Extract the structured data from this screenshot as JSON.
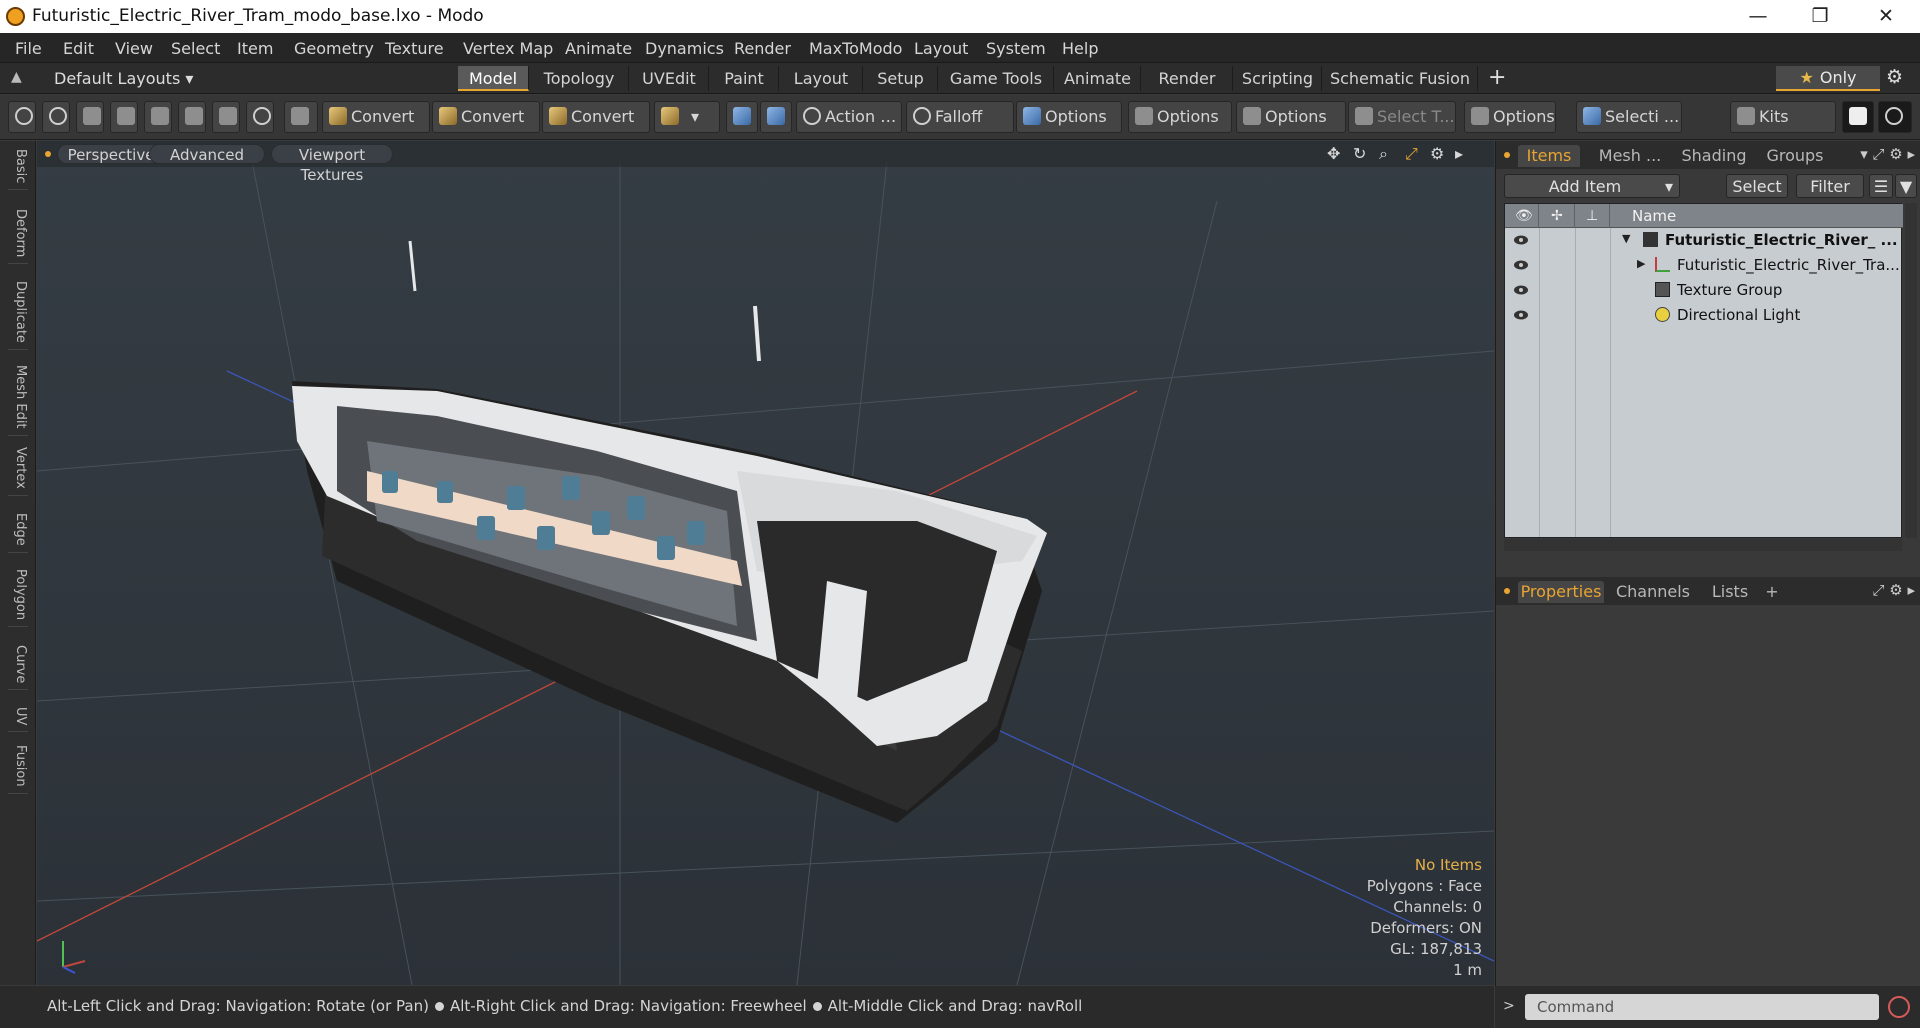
{
  "window": {
    "title": "Futuristic_Electric_River_Tram_modo_base.lxo - Modo",
    "minimize": "—",
    "maximize": "❐",
    "close": "✕"
  },
  "menu": [
    "File",
    "Edit",
    "View",
    "Select",
    "Item",
    "Geometry",
    "Texture",
    "Vertex Map",
    "Animate",
    "Dynamics",
    "Render",
    "MaxToModo",
    "Layout",
    "System",
    "Help"
  ],
  "layout_tabs": {
    "selector": "Default Layouts ▾",
    "tabs": [
      "Model",
      "Topology",
      "UVEdit",
      "Paint",
      "Layout",
      "Setup",
      "Game Tools",
      "Animate",
      "Render",
      "Scripting",
      "Schematic Fusion"
    ],
    "active": "Model",
    "plus": "+",
    "only": "Only",
    "star": "★",
    "gear": "⚙"
  },
  "toolbar": {
    "convert1": "Convert",
    "convert2": "Convert",
    "convert3": "Convert",
    "action": "Action",
    "ellipsis": "…",
    "falloff": "Falloff",
    "options1": "Options",
    "options2": "Options",
    "options3": "Options",
    "select_t": "Select T...",
    "options4": "Options",
    "selecti": "Selecti ...",
    "kits": "Kits"
  },
  "left_tabs": [
    "Basic",
    "Deform",
    "Duplicate",
    "Mesh Edit",
    "Vertex",
    "Edge",
    "Polygon",
    "Curve",
    "UV",
    "Fusion"
  ],
  "viewport": {
    "view_mode": "Perspective",
    "shading": "Advanced",
    "textures": "Viewport Textures",
    "info": {
      "selection": "No Items",
      "polygons": "Polygons : Face",
      "channels": "Channels: 0",
      "deformers": "Deformers: ON",
      "gl": "GL: 187,813",
      "scale": "1 m"
    },
    "colors": {
      "background": "#2f363c",
      "x_axis": "#c0473a",
      "z_axis": "#3b56b8"
    }
  },
  "status": {
    "hint1": "Alt-Left Click and Drag: Navigation: Rotate (or Pan)",
    "hint2": "Alt-Right Click and Drag: Navigation: Freewheel",
    "hint3": "Alt-Middle Click and Drag: navRoll"
  },
  "items_panel": {
    "tabs": [
      "Items",
      "Mesh ...",
      "Shading",
      "Groups"
    ],
    "active": "Items",
    "add_item": "Add Item",
    "select": "Select",
    "filter": "Filter",
    "column_name": "Name",
    "rows": [
      {
        "label": "Futuristic_Electric_River_ ...",
        "icon": "scene-icon"
      },
      {
        "label": "Futuristic_Electric_River_Tra...",
        "icon": "mesh-icon"
      },
      {
        "label": "Texture Group",
        "icon": "texture-group-icon"
      },
      {
        "label": "Directional Light",
        "icon": "light-icon"
      }
    ]
  },
  "properties_panel": {
    "tabs": [
      "Properties",
      "Channels",
      "Lists"
    ],
    "active": "Properties",
    "plus": "+"
  },
  "command": {
    "placeholder": "Command"
  },
  "accent_color": "#e8a531"
}
